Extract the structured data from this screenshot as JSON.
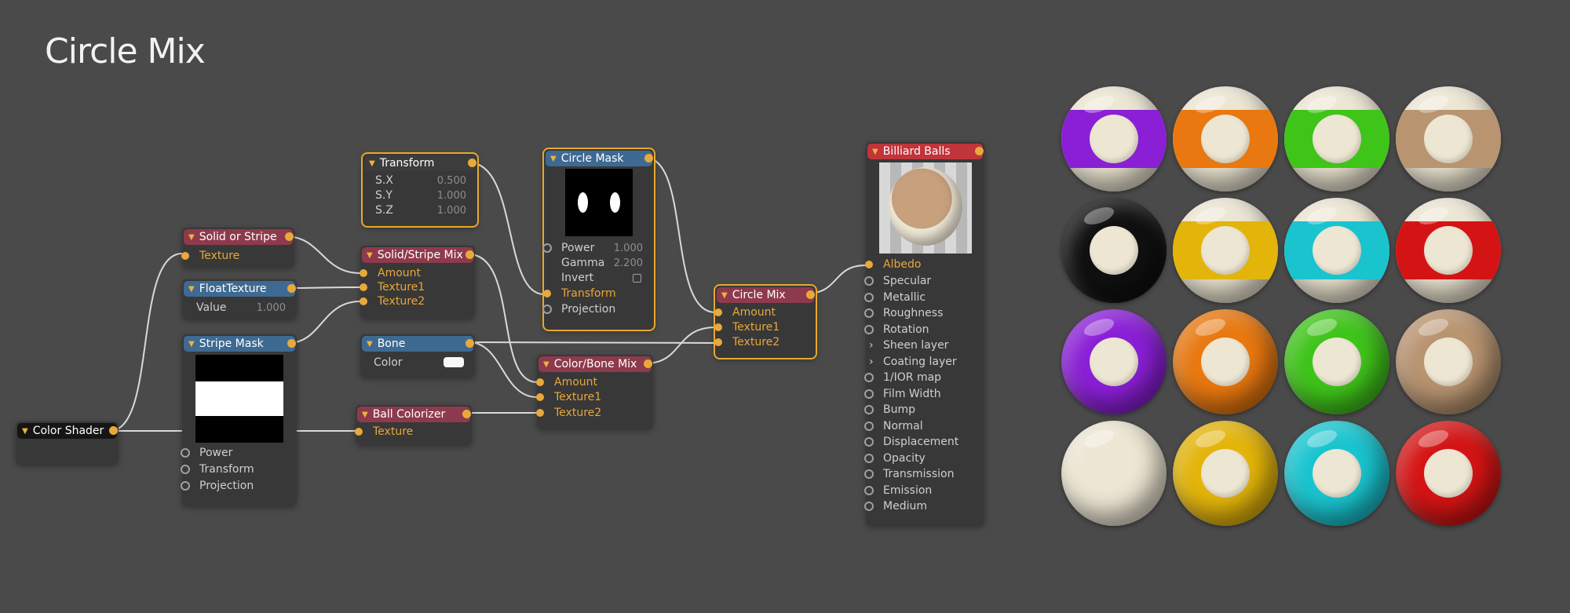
{
  "title": "Circle Mix",
  "nodes": {
    "color_shader": {
      "title": "Color Shader"
    },
    "solid_or_stripe": {
      "title": "Solid or Stripe",
      "inputs": [
        "Texture"
      ]
    },
    "float_texture": {
      "title": "FloatTexture",
      "value_label": "Value",
      "value": "1.000"
    },
    "stripe_mask": {
      "title": "Stripe Mask",
      "params": [
        "Power",
        "Transform",
        "Projection"
      ]
    },
    "transform": {
      "title": "Transform",
      "params": [
        {
          "label": "S.X",
          "value": "0.500"
        },
        {
          "label": "S.Y",
          "value": "1.000"
        },
        {
          "label": "S.Z",
          "value": "1.000"
        }
      ]
    },
    "solid_stripe_mix": {
      "title": "Solid/Stripe Mix",
      "inputs": [
        "Amount",
        "Texture1",
        "Texture2"
      ]
    },
    "bone": {
      "title": "Bone",
      "color_label": "Color"
    },
    "ball_colorizer": {
      "title": "Ball Colorizer",
      "inputs": [
        "Texture"
      ]
    },
    "circle_mask": {
      "title": "Circle Mask",
      "params": [
        {
          "label": "Power",
          "value": "1.000"
        },
        {
          "label": "Gamma",
          "value": "2.200"
        },
        {
          "label": "Invert",
          "value": ""
        }
      ],
      "inputs": [
        "Transform"
      ],
      "extra": [
        "Projection"
      ]
    },
    "color_bone_mix": {
      "title": "Color/Bone Mix",
      "inputs": [
        "Amount",
        "Texture1",
        "Texture2"
      ]
    },
    "circle_mix": {
      "title": "Circle Mix",
      "inputs": [
        "Amount",
        "Texture1",
        "Texture2"
      ]
    },
    "billiard_balls": {
      "title": "Billiard Balls",
      "albedo": "Albedo",
      "params": [
        "Specular",
        "Metallic",
        "Roughness",
        "Rotation",
        "Sheen layer",
        "Coating layer",
        "1/IOR map",
        "Film Width",
        "Bump",
        "Normal",
        "Displacement",
        "Opacity",
        "Transmission",
        "Emission",
        "Medium"
      ]
    }
  },
  "colors": {
    "background": "#4a4a4a",
    "wire": "#d9d9d9",
    "accent": "#e8a93a",
    "header_red": "#8e3a4d",
    "header_blue": "#3e6a92"
  },
  "balls": [
    {
      "color": "#8a1fd6",
      "style": "stripe"
    },
    {
      "color": "#e8780f",
      "style": "stripe"
    },
    {
      "color": "#3fc41a",
      "style": "stripe"
    },
    {
      "color": "#b89470",
      "style": "stripe"
    },
    {
      "color": "#101010",
      "style": "solid"
    },
    {
      "color": "#e3b40a",
      "style": "stripe"
    },
    {
      "color": "#19c4cf",
      "style": "stripe"
    },
    {
      "color": "#d41414",
      "style": "stripe"
    },
    {
      "color": "#8a1fd6",
      "style": "solid"
    },
    {
      "color": "#e8780f",
      "style": "solid"
    },
    {
      "color": "#3fc41a",
      "style": "solid"
    },
    {
      "color": "#b89470",
      "style": "solid"
    },
    {
      "color": "#ede6d3",
      "style": "plain"
    },
    {
      "color": "#e3b40a",
      "style": "solid"
    },
    {
      "color": "#19c4cf",
      "style": "solid"
    },
    {
      "color": "#d41414",
      "style": "solid"
    }
  ]
}
